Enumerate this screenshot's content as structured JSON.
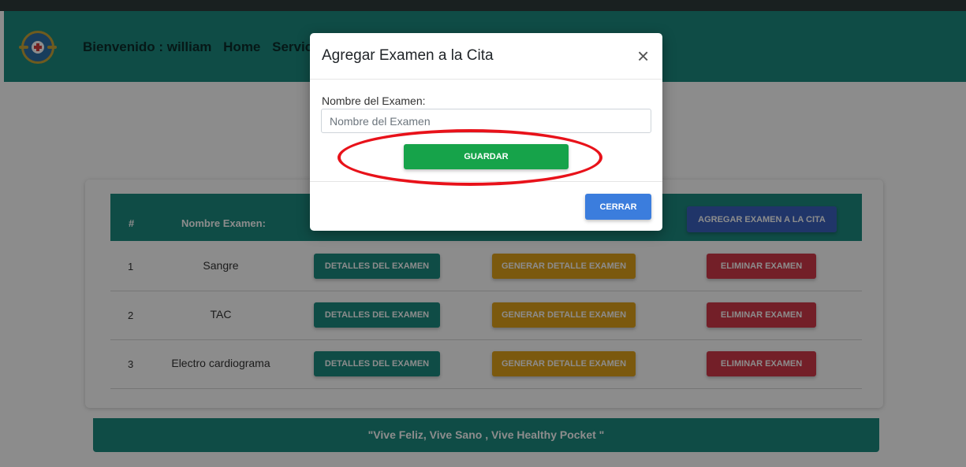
{
  "nav": {
    "welcome": "Bienvenido : william",
    "home": "Home",
    "services": "Services"
  },
  "table": {
    "headers": [
      "#",
      "Nombre Examen:"
    ],
    "add_button": "AGREGAR EXAMEN A LA CITA",
    "rows": [
      {
        "num": "1",
        "name": "Sangre"
      },
      {
        "num": "2",
        "name": "TAC"
      },
      {
        "num": "3",
        "name": "Electro cardiograma"
      }
    ],
    "details_label": "DETALLES DEL EXAMEN",
    "generate_label": "GENERAR DETALLE EXAMEN",
    "delete_label": "ELIMINAR EXAMEN"
  },
  "footer": {
    "text": "\"Vive Feliz, Vive Sano , Vive Healthy Pocket \""
  },
  "modal": {
    "title": "Agregar Examen a la Cita",
    "close_glyph": "×",
    "field_label": "Nombre del Examen:",
    "field_placeholder": "Nombre del Examen",
    "field_value": "",
    "save_label": "GUARDAR",
    "close_label": "CERRAR"
  },
  "colors": {
    "primary": "#1d8a80",
    "save": "#16a34a",
    "close": "#3b7ddd",
    "add": "#3b62c0",
    "generate": "#e0a21a",
    "delete": "#d23a4a",
    "highlight": "#e8121a"
  }
}
